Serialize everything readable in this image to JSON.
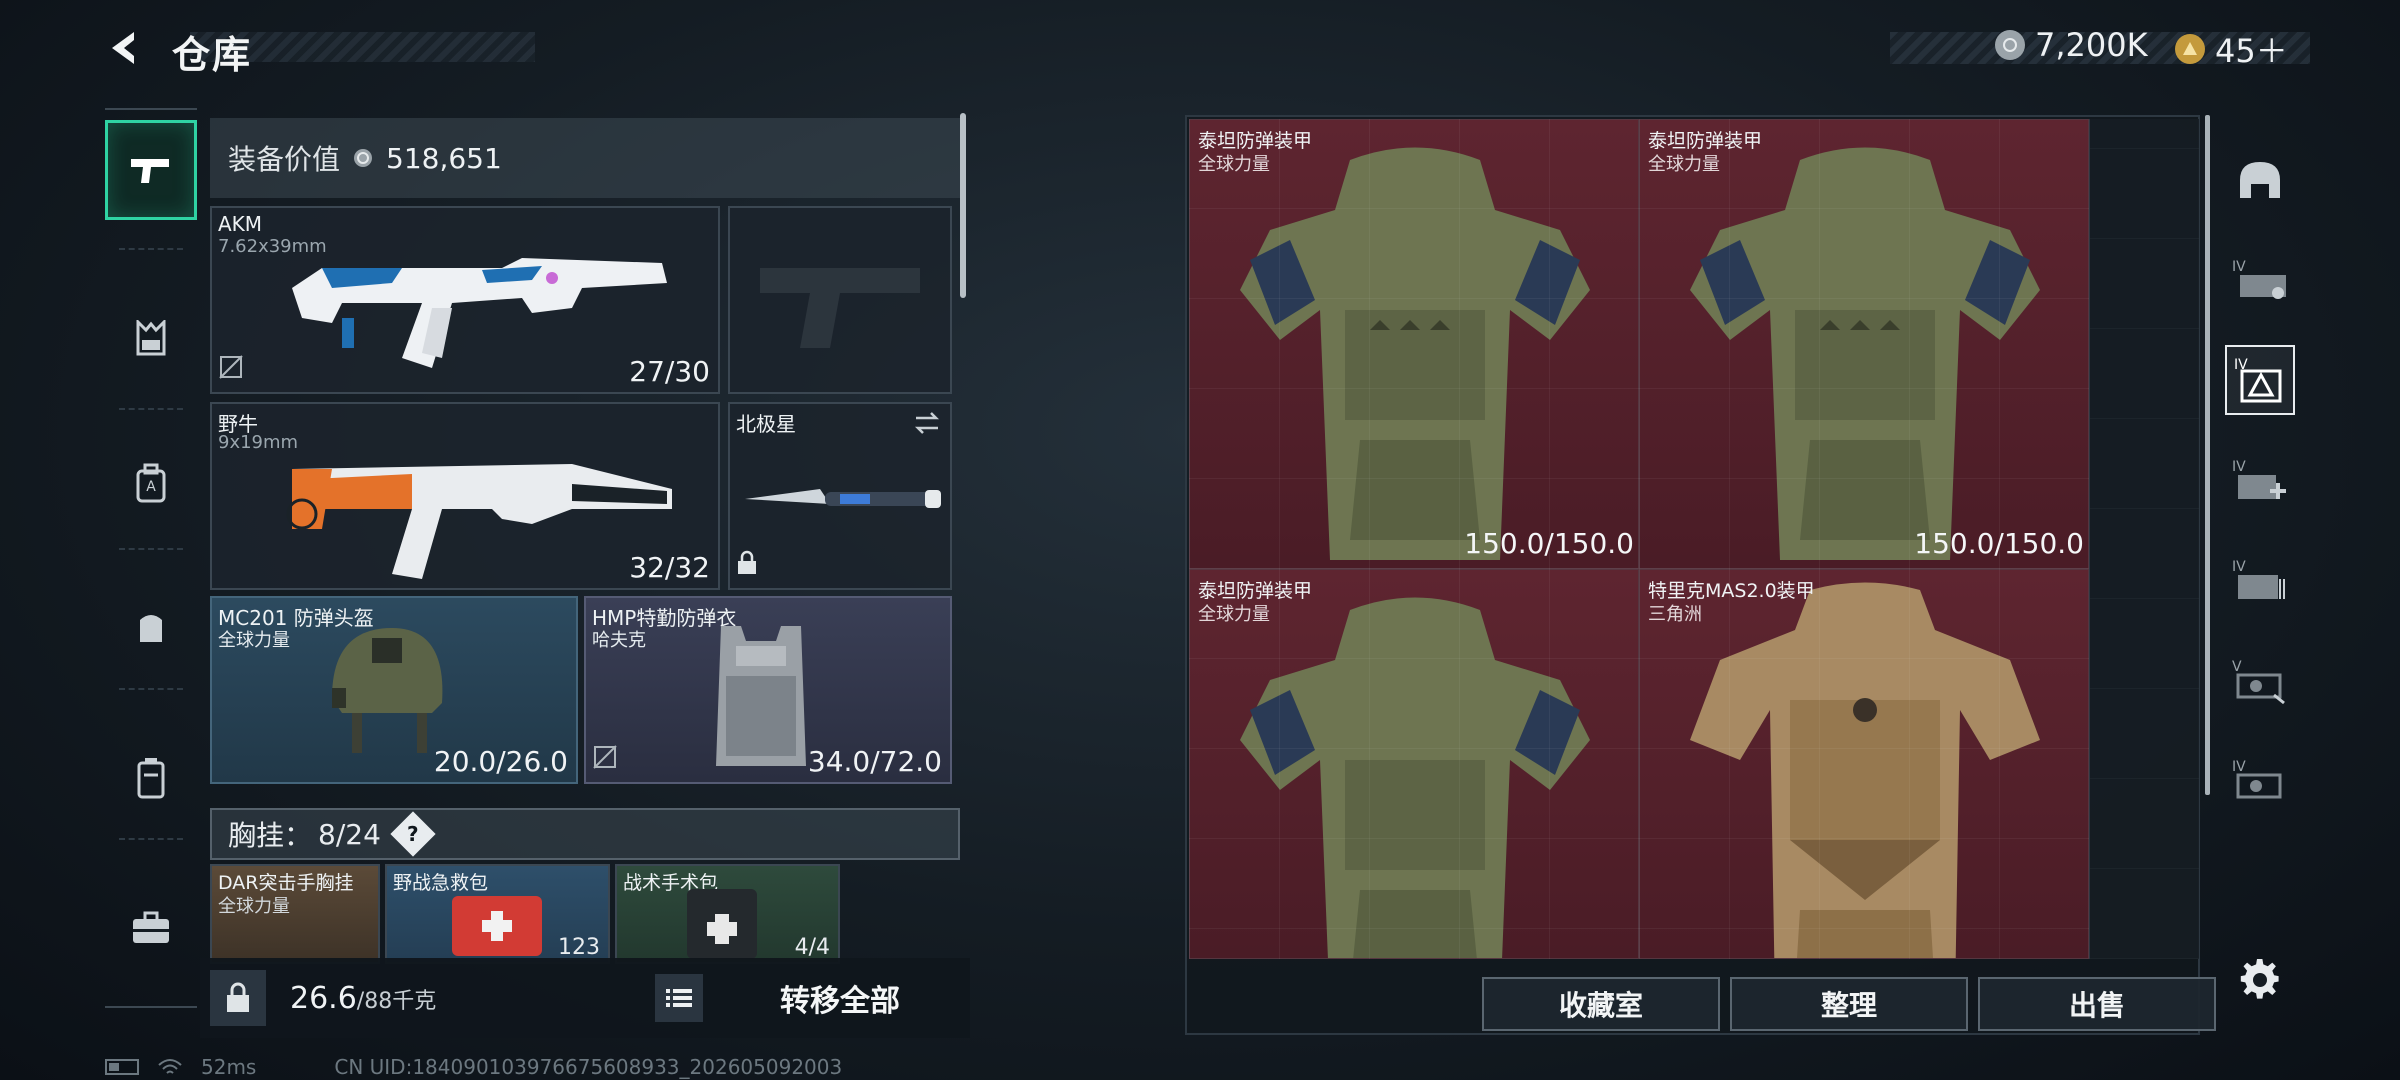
{
  "header": {
    "title": "仓库",
    "currencies": [
      {
        "icon": "silver-coin-icon",
        "value": "7,200K",
        "color": "#c9cfd3"
      },
      {
        "icon": "gold-coin-icon",
        "value": "45＋",
        "color": "#d8b35a"
      }
    ]
  },
  "left_nav": {
    "items": [
      {
        "name": "weapons",
        "icon": "pistol-icon",
        "active": true
      },
      {
        "name": "vests",
        "icon": "chest-rig-icon",
        "active": false
      },
      {
        "name": "backpacks",
        "icon": "backpack-icon",
        "active": false
      },
      {
        "name": "bags",
        "icon": "pouch-icon",
        "active": false
      },
      {
        "name": "containers",
        "icon": "canister-icon",
        "active": false
      },
      {
        "name": "tools",
        "icon": "briefcase-icon",
        "active": false
      }
    ]
  },
  "loadout": {
    "value_label": "装备价值",
    "value": "518,651",
    "primary": {
      "name": "AKM",
      "caliber": "7.62x39mm",
      "ammo": "27/30"
    },
    "secondary": {
      "name": "野牛",
      "caliber": "9x19mm",
      "ammo": "32/32"
    },
    "pistol": {
      "name": "",
      "empty": true
    },
    "melee": {
      "name": "北极星"
    },
    "helmet": {
      "name": "MC201 防弹头盔",
      "faction": "全球力量",
      "durability": "20.0/26.0"
    },
    "armor": {
      "name": "HMP特勤防弹衣",
      "faction": "哈夫克",
      "durability": "34.0/72.0"
    },
    "chest_rig_label": "胸挂：",
    "chest_rig_capacity": "8/24",
    "chest_rig_help": "?",
    "rig_items": [
      {
        "name": "DAR突击手胸挂",
        "faction": "全球力量"
      },
      {
        "name": "野战急救包",
        "count": "123"
      },
      {
        "name": "战术手术包",
        "count": "4/4"
      }
    ],
    "weight_value": "26.6",
    "weight_max": "/88千克",
    "transfer_all": "转移全部"
  },
  "storage": {
    "items": [
      {
        "name": "泰坦防弹装甲",
        "faction": "全球力量",
        "durability": "150.0/150.0"
      },
      {
        "name": "泰坦防弹装甲",
        "faction": "全球力量",
        "durability": "150.0/150.0"
      },
      {
        "name": "泰坦防弹装甲",
        "faction": "全球力量",
        "durability": ""
      },
      {
        "name": "特里克MAS2.0装甲",
        "faction": "三角洲",
        "durability": ""
      }
    ],
    "buttons": {
      "collection": "收藏室",
      "organize": "整理",
      "sell": "出售"
    }
  },
  "filters": {
    "items": [
      {
        "name": "helmet-filter-icon",
        "level": ""
      },
      {
        "name": "armor-filter-icon",
        "level": "IV"
      },
      {
        "name": "rig-filter-icon",
        "level": "IV"
      },
      {
        "name": "medical-filter-icon",
        "level": "IV"
      },
      {
        "name": "ammo-filter-icon",
        "level": "IV"
      },
      {
        "name": "key-filter-icon",
        "level": "V"
      },
      {
        "name": "misc-filter-icon",
        "level": "IV"
      }
    ]
  },
  "status_bar": {
    "ping": "52ms",
    "uid": "CN UID:18409010397667560893​3_202605092003"
  }
}
